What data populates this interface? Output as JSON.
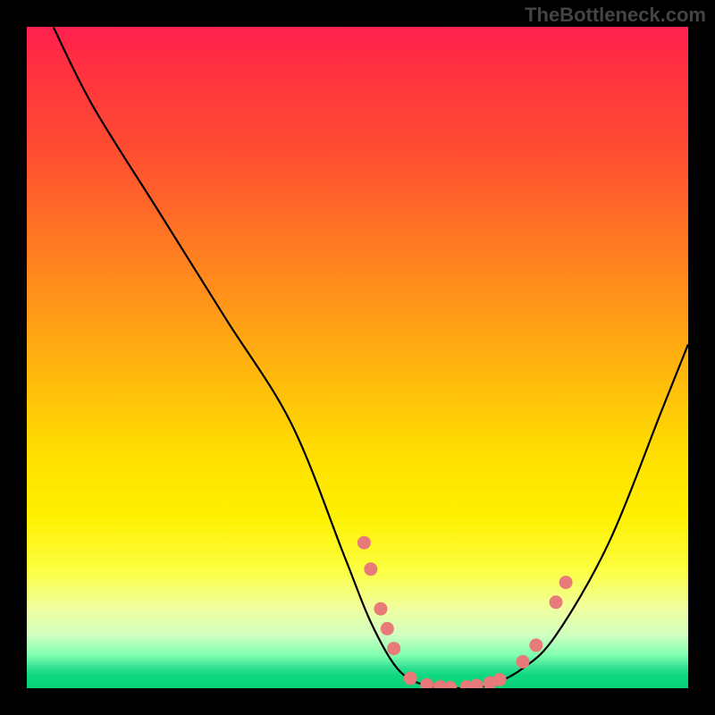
{
  "attribution": "TheBottleneck.com",
  "chart_data": {
    "type": "line",
    "title": "",
    "xlabel": "",
    "ylabel": "",
    "xlim": [
      0,
      100
    ],
    "ylim": [
      0,
      100
    ],
    "series": [
      {
        "name": "bottleneck-curve",
        "x": [
          4,
          10,
          20,
          30,
          40,
          48,
          52,
          56,
          60,
          65,
          70,
          75,
          80,
          88,
          96,
          100
        ],
        "y": [
          100,
          88,
          72,
          56,
          40,
          20,
          10,
          3,
          0.5,
          0,
          0.5,
          3,
          8,
          22,
          42,
          52
        ]
      }
    ],
    "markers": {
      "name": "highlight-points",
      "color": "#e97a7a",
      "points": [
        {
          "x": 51.0,
          "y": 22.0
        },
        {
          "x": 52.0,
          "y": 18.0
        },
        {
          "x": 53.5,
          "y": 12.0
        },
        {
          "x": 54.5,
          "y": 9.0
        },
        {
          "x": 55.5,
          "y": 6.0
        },
        {
          "x": 58.0,
          "y": 1.5
        },
        {
          "x": 60.5,
          "y": 0.5
        },
        {
          "x": 62.5,
          "y": 0.2
        },
        {
          "x": 64.0,
          "y": 0.1
        },
        {
          "x": 66.5,
          "y": 0.2
        },
        {
          "x": 68.0,
          "y": 0.4
        },
        {
          "x": 70.0,
          "y": 0.8
        },
        {
          "x": 71.5,
          "y": 1.3
        },
        {
          "x": 75.0,
          "y": 4.0
        },
        {
          "x": 77.0,
          "y": 6.5
        },
        {
          "x": 80.0,
          "y": 13.0
        },
        {
          "x": 81.5,
          "y": 16.0
        }
      ]
    }
  }
}
